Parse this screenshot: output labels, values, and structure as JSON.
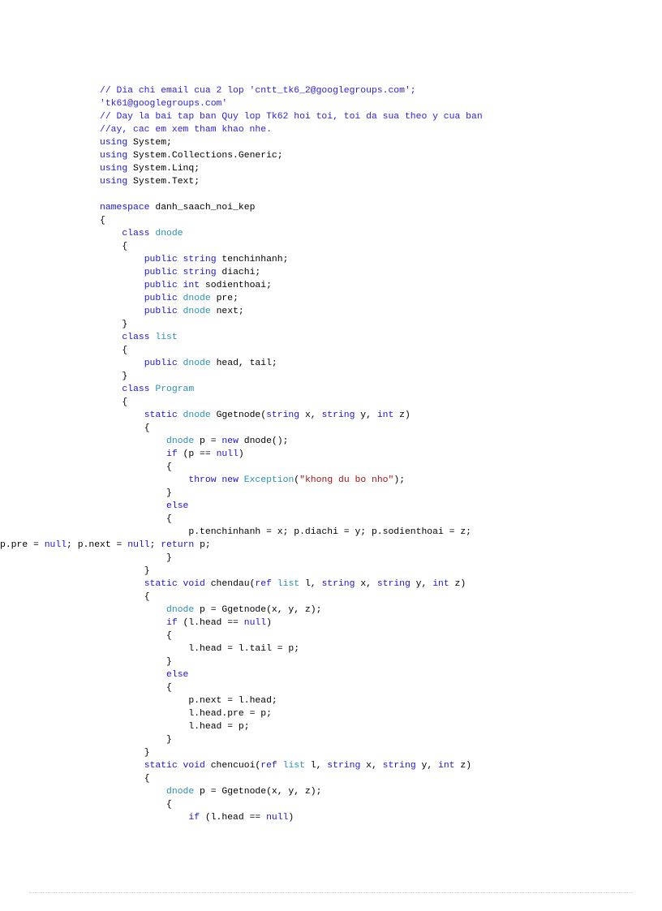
{
  "document": {
    "language": "csharp",
    "colors": {
      "background": "#ffffff",
      "plain": "#000000",
      "keyword": "#1c16d2",
      "type": "#2b91af",
      "string": "#a31515",
      "comment": "#2c22e0",
      "footer_rule": "#c8c8c8"
    },
    "lines": [
      {
        "n": 1,
        "indent": 0,
        "wrap": false,
        "tokens": [
          {
            "t": "cmt",
            "v": "// Dia chi email cua 2 lop 'cntt_tk6_2@googlegroups.com';"
          }
        ]
      },
      {
        "n": 2,
        "indent": 0,
        "wrap": false,
        "tokens": [
          {
            "t": "cmt",
            "v": "'tk61@googlegroups.com'"
          }
        ]
      },
      {
        "n": 3,
        "indent": 0,
        "wrap": false,
        "tokens": [
          {
            "t": "cmt",
            "v": "// Day la bai tap ban Quy lop Tk62 hoi toi, toi da sua theo y cua ban"
          }
        ]
      },
      {
        "n": 4,
        "indent": 0,
        "wrap": false,
        "tokens": [
          {
            "t": "cmt",
            "v": "//ay, cac em xem tham khao nhe."
          }
        ]
      },
      {
        "n": 5,
        "indent": 0,
        "wrap": false,
        "tokens": [
          {
            "t": "kw",
            "v": "using"
          },
          {
            "t": "pln",
            "v": " System;"
          }
        ]
      },
      {
        "n": 6,
        "indent": 0,
        "wrap": false,
        "tokens": [
          {
            "t": "kw",
            "v": "using"
          },
          {
            "t": "pln",
            "v": " System.Collections.Generic;"
          }
        ]
      },
      {
        "n": 7,
        "indent": 0,
        "wrap": false,
        "tokens": [
          {
            "t": "kw",
            "v": "using"
          },
          {
            "t": "pln",
            "v": " System.Linq;"
          }
        ]
      },
      {
        "n": 8,
        "indent": 0,
        "wrap": false,
        "tokens": [
          {
            "t": "kw",
            "v": "using"
          },
          {
            "t": "pln",
            "v": " System.Text;"
          }
        ]
      },
      {
        "n": 9,
        "indent": 0,
        "wrap": false,
        "tokens": []
      },
      {
        "n": 10,
        "indent": 0,
        "wrap": false,
        "tokens": [
          {
            "t": "kw",
            "v": "namespace"
          },
          {
            "t": "pln",
            "v": " danh_saach_noi_kep"
          }
        ]
      },
      {
        "n": 11,
        "indent": 0,
        "wrap": false,
        "tokens": [
          {
            "t": "pln",
            "v": "{"
          }
        ]
      },
      {
        "n": 12,
        "indent": 1,
        "wrap": false,
        "tokens": [
          {
            "t": "kw",
            "v": "class"
          },
          {
            "t": "pln",
            "v": " "
          },
          {
            "t": "typ",
            "v": "dnode"
          }
        ]
      },
      {
        "n": 13,
        "indent": 1,
        "wrap": false,
        "tokens": [
          {
            "t": "pln",
            "v": "{"
          }
        ]
      },
      {
        "n": 14,
        "indent": 2,
        "wrap": false,
        "tokens": [
          {
            "t": "kw",
            "v": "public"
          },
          {
            "t": "pln",
            "v": " "
          },
          {
            "t": "kw",
            "v": "string"
          },
          {
            "t": "pln",
            "v": " tenchinhanh;"
          }
        ]
      },
      {
        "n": 15,
        "indent": 2,
        "wrap": false,
        "tokens": [
          {
            "t": "kw",
            "v": "public"
          },
          {
            "t": "pln",
            "v": " "
          },
          {
            "t": "kw",
            "v": "string"
          },
          {
            "t": "pln",
            "v": " diachi;"
          }
        ]
      },
      {
        "n": 16,
        "indent": 2,
        "wrap": false,
        "tokens": [
          {
            "t": "kw",
            "v": "public"
          },
          {
            "t": "pln",
            "v": " "
          },
          {
            "t": "kw",
            "v": "int"
          },
          {
            "t": "pln",
            "v": " sodienthoai;"
          }
        ]
      },
      {
        "n": 17,
        "indent": 2,
        "wrap": false,
        "tokens": [
          {
            "t": "kw",
            "v": "public"
          },
          {
            "t": "pln",
            "v": " "
          },
          {
            "t": "typ",
            "v": "dnode"
          },
          {
            "t": "pln",
            "v": " pre;"
          }
        ]
      },
      {
        "n": 18,
        "indent": 2,
        "wrap": false,
        "tokens": [
          {
            "t": "kw",
            "v": "public"
          },
          {
            "t": "pln",
            "v": " "
          },
          {
            "t": "typ",
            "v": "dnode"
          },
          {
            "t": "pln",
            "v": " next;"
          }
        ]
      },
      {
        "n": 19,
        "indent": 1,
        "wrap": false,
        "tokens": [
          {
            "t": "pln",
            "v": "}"
          }
        ]
      },
      {
        "n": 20,
        "indent": 1,
        "wrap": false,
        "tokens": [
          {
            "t": "kw",
            "v": "class"
          },
          {
            "t": "pln",
            "v": " "
          },
          {
            "t": "typ",
            "v": "list"
          }
        ]
      },
      {
        "n": 21,
        "indent": 1,
        "wrap": false,
        "tokens": [
          {
            "t": "pln",
            "v": "{"
          }
        ]
      },
      {
        "n": 22,
        "indent": 2,
        "wrap": false,
        "tokens": [
          {
            "t": "kw",
            "v": "public"
          },
          {
            "t": "pln",
            "v": " "
          },
          {
            "t": "typ",
            "v": "dnode"
          },
          {
            "t": "pln",
            "v": " head, tail;"
          }
        ]
      },
      {
        "n": 23,
        "indent": 1,
        "wrap": false,
        "tokens": [
          {
            "t": "pln",
            "v": "}"
          }
        ]
      },
      {
        "n": 24,
        "indent": 1,
        "wrap": false,
        "tokens": [
          {
            "t": "kw",
            "v": "class"
          },
          {
            "t": "pln",
            "v": " "
          },
          {
            "t": "typ",
            "v": "Program"
          }
        ]
      },
      {
        "n": 25,
        "indent": 1,
        "wrap": false,
        "tokens": [
          {
            "t": "pln",
            "v": "{"
          }
        ]
      },
      {
        "n": 26,
        "indent": 2,
        "wrap": false,
        "tokens": [
          {
            "t": "kw",
            "v": "static"
          },
          {
            "t": "pln",
            "v": " "
          },
          {
            "t": "typ",
            "v": "dnode"
          },
          {
            "t": "pln",
            "v": " Ggetnode("
          },
          {
            "t": "kw",
            "v": "string"
          },
          {
            "t": "pln",
            "v": " x, "
          },
          {
            "t": "kw",
            "v": "string"
          },
          {
            "t": "pln",
            "v": " y, "
          },
          {
            "t": "kw",
            "v": "int"
          },
          {
            "t": "pln",
            "v": " z)"
          }
        ]
      },
      {
        "n": 27,
        "indent": 2,
        "wrap": false,
        "tokens": [
          {
            "t": "pln",
            "v": "{"
          }
        ]
      },
      {
        "n": 28,
        "indent": 3,
        "wrap": false,
        "tokens": [
          {
            "t": "typ",
            "v": "dnode"
          },
          {
            "t": "pln",
            "v": " p = "
          },
          {
            "t": "kw",
            "v": "new"
          },
          {
            "t": "pln",
            "v": " dnode();"
          }
        ]
      },
      {
        "n": 29,
        "indent": 3,
        "wrap": false,
        "tokens": [
          {
            "t": "kw",
            "v": "if"
          },
          {
            "t": "pln",
            "v": " (p == "
          },
          {
            "t": "kw",
            "v": "null"
          },
          {
            "t": "pln",
            "v": ")"
          }
        ]
      },
      {
        "n": 30,
        "indent": 3,
        "wrap": false,
        "tokens": [
          {
            "t": "pln",
            "v": "{"
          }
        ]
      },
      {
        "n": 31,
        "indent": 4,
        "wrap": false,
        "tokens": [
          {
            "t": "kw",
            "v": "throw"
          },
          {
            "t": "pln",
            "v": " "
          },
          {
            "t": "kw",
            "v": "new"
          },
          {
            "t": "pln",
            "v": " "
          },
          {
            "t": "typ",
            "v": "Exception"
          },
          {
            "t": "pln",
            "v": "("
          },
          {
            "t": "str",
            "v": "\"khong du bo nho\""
          },
          {
            "t": "pln",
            "v": ");"
          }
        ]
      },
      {
        "n": 32,
        "indent": 3,
        "wrap": false,
        "tokens": [
          {
            "t": "pln",
            "v": "}"
          }
        ]
      },
      {
        "n": 33,
        "indent": 3,
        "wrap": false,
        "tokens": [
          {
            "t": "kw",
            "v": "else"
          }
        ]
      },
      {
        "n": 34,
        "indent": 3,
        "wrap": false,
        "tokens": [
          {
            "t": "pln",
            "v": "{"
          }
        ]
      },
      {
        "n": 35,
        "indent": 4,
        "wrap": false,
        "tokens": [
          {
            "t": "pln",
            "v": "p.tenchinhanh = x; p.diachi = y; p.sodienthoai = z;"
          }
        ]
      },
      {
        "n": 36,
        "indent": 0,
        "wrap": true,
        "tokens": [
          {
            "t": "pln",
            "v": "p.pre = "
          },
          {
            "t": "kw",
            "v": "null"
          },
          {
            "t": "pln",
            "v": "; p.next = "
          },
          {
            "t": "kw",
            "v": "null"
          },
          {
            "t": "pln",
            "v": "; "
          },
          {
            "t": "kw",
            "v": "return"
          },
          {
            "t": "pln",
            "v": " p;"
          }
        ]
      },
      {
        "n": 37,
        "indent": 3,
        "wrap": false,
        "tokens": [
          {
            "t": "pln",
            "v": "}"
          }
        ]
      },
      {
        "n": 38,
        "indent": 2,
        "wrap": false,
        "tokens": [
          {
            "t": "pln",
            "v": "}"
          }
        ]
      },
      {
        "n": 39,
        "indent": 2,
        "wrap": false,
        "tokens": [
          {
            "t": "kw",
            "v": "static"
          },
          {
            "t": "pln",
            "v": " "
          },
          {
            "t": "kw",
            "v": "void"
          },
          {
            "t": "pln",
            "v": " chendau("
          },
          {
            "t": "kw",
            "v": "ref"
          },
          {
            "t": "pln",
            "v": " "
          },
          {
            "t": "typ",
            "v": "list"
          },
          {
            "t": "pln",
            "v": " l, "
          },
          {
            "t": "kw",
            "v": "string"
          },
          {
            "t": "pln",
            "v": " x, "
          },
          {
            "t": "kw",
            "v": "string"
          },
          {
            "t": "pln",
            "v": " y, "
          },
          {
            "t": "kw",
            "v": "int"
          },
          {
            "t": "pln",
            "v": " z)"
          }
        ]
      },
      {
        "n": 40,
        "indent": 2,
        "wrap": false,
        "tokens": [
          {
            "t": "pln",
            "v": "{"
          }
        ]
      },
      {
        "n": 41,
        "indent": 3,
        "wrap": false,
        "tokens": [
          {
            "t": "typ",
            "v": "dnode"
          },
          {
            "t": "pln",
            "v": " p = Ggetnode(x, y, z);"
          }
        ]
      },
      {
        "n": 42,
        "indent": 3,
        "wrap": false,
        "tokens": [
          {
            "t": "kw",
            "v": "if"
          },
          {
            "t": "pln",
            "v": " (l.head == "
          },
          {
            "t": "kw",
            "v": "null"
          },
          {
            "t": "pln",
            "v": ")"
          }
        ]
      },
      {
        "n": 43,
        "indent": 3,
        "wrap": false,
        "tokens": [
          {
            "t": "pln",
            "v": "{"
          }
        ]
      },
      {
        "n": 44,
        "indent": 4,
        "wrap": false,
        "tokens": [
          {
            "t": "pln",
            "v": "l.head = l.tail = p;"
          }
        ]
      },
      {
        "n": 45,
        "indent": 3,
        "wrap": false,
        "tokens": [
          {
            "t": "pln",
            "v": "}"
          }
        ]
      },
      {
        "n": 46,
        "indent": 3,
        "wrap": false,
        "tokens": [
          {
            "t": "kw",
            "v": "else"
          }
        ]
      },
      {
        "n": 47,
        "indent": 3,
        "wrap": false,
        "tokens": [
          {
            "t": "pln",
            "v": "{"
          }
        ]
      },
      {
        "n": 48,
        "indent": 4,
        "wrap": false,
        "tokens": [
          {
            "t": "pln",
            "v": "p.next = l.head;"
          }
        ]
      },
      {
        "n": 49,
        "indent": 4,
        "wrap": false,
        "tokens": [
          {
            "t": "pln",
            "v": "l.head.pre = p;"
          }
        ]
      },
      {
        "n": 50,
        "indent": 4,
        "wrap": false,
        "tokens": [
          {
            "t": "pln",
            "v": "l.head = p;"
          }
        ]
      },
      {
        "n": 51,
        "indent": 3,
        "wrap": false,
        "tokens": [
          {
            "t": "pln",
            "v": "}"
          }
        ]
      },
      {
        "n": 52,
        "indent": 2,
        "wrap": false,
        "tokens": [
          {
            "t": "pln",
            "v": "}"
          }
        ]
      },
      {
        "n": 53,
        "indent": 2,
        "wrap": false,
        "tokens": [
          {
            "t": "kw",
            "v": "static"
          },
          {
            "t": "pln",
            "v": " "
          },
          {
            "t": "kw",
            "v": "void"
          },
          {
            "t": "pln",
            "v": " chencuoi("
          },
          {
            "t": "kw",
            "v": "ref"
          },
          {
            "t": "pln",
            "v": " "
          },
          {
            "t": "typ",
            "v": "list"
          },
          {
            "t": "pln",
            "v": " l, "
          },
          {
            "t": "kw",
            "v": "string"
          },
          {
            "t": "pln",
            "v": " x, "
          },
          {
            "t": "kw",
            "v": "string"
          },
          {
            "t": "pln",
            "v": " y, "
          },
          {
            "t": "kw",
            "v": "int"
          },
          {
            "t": "pln",
            "v": " z)"
          }
        ]
      },
      {
        "n": 54,
        "indent": 2,
        "wrap": false,
        "tokens": [
          {
            "t": "pln",
            "v": "{"
          }
        ]
      },
      {
        "n": 55,
        "indent": 3,
        "wrap": false,
        "tokens": [
          {
            "t": "typ",
            "v": "dnode"
          },
          {
            "t": "pln",
            "v": " p = Ggetnode(x, y, z);"
          }
        ]
      },
      {
        "n": 56,
        "indent": 3,
        "wrap": false,
        "tokens": [
          {
            "t": "pln",
            "v": "{"
          }
        ]
      },
      {
        "n": 57,
        "indent": 4,
        "wrap": false,
        "tokens": [
          {
            "t": "kw",
            "v": "if"
          },
          {
            "t": "pln",
            "v": " (l.head == "
          },
          {
            "t": "kw",
            "v": "null"
          },
          {
            "t": "pln",
            "v": ")"
          }
        ]
      }
    ]
  }
}
